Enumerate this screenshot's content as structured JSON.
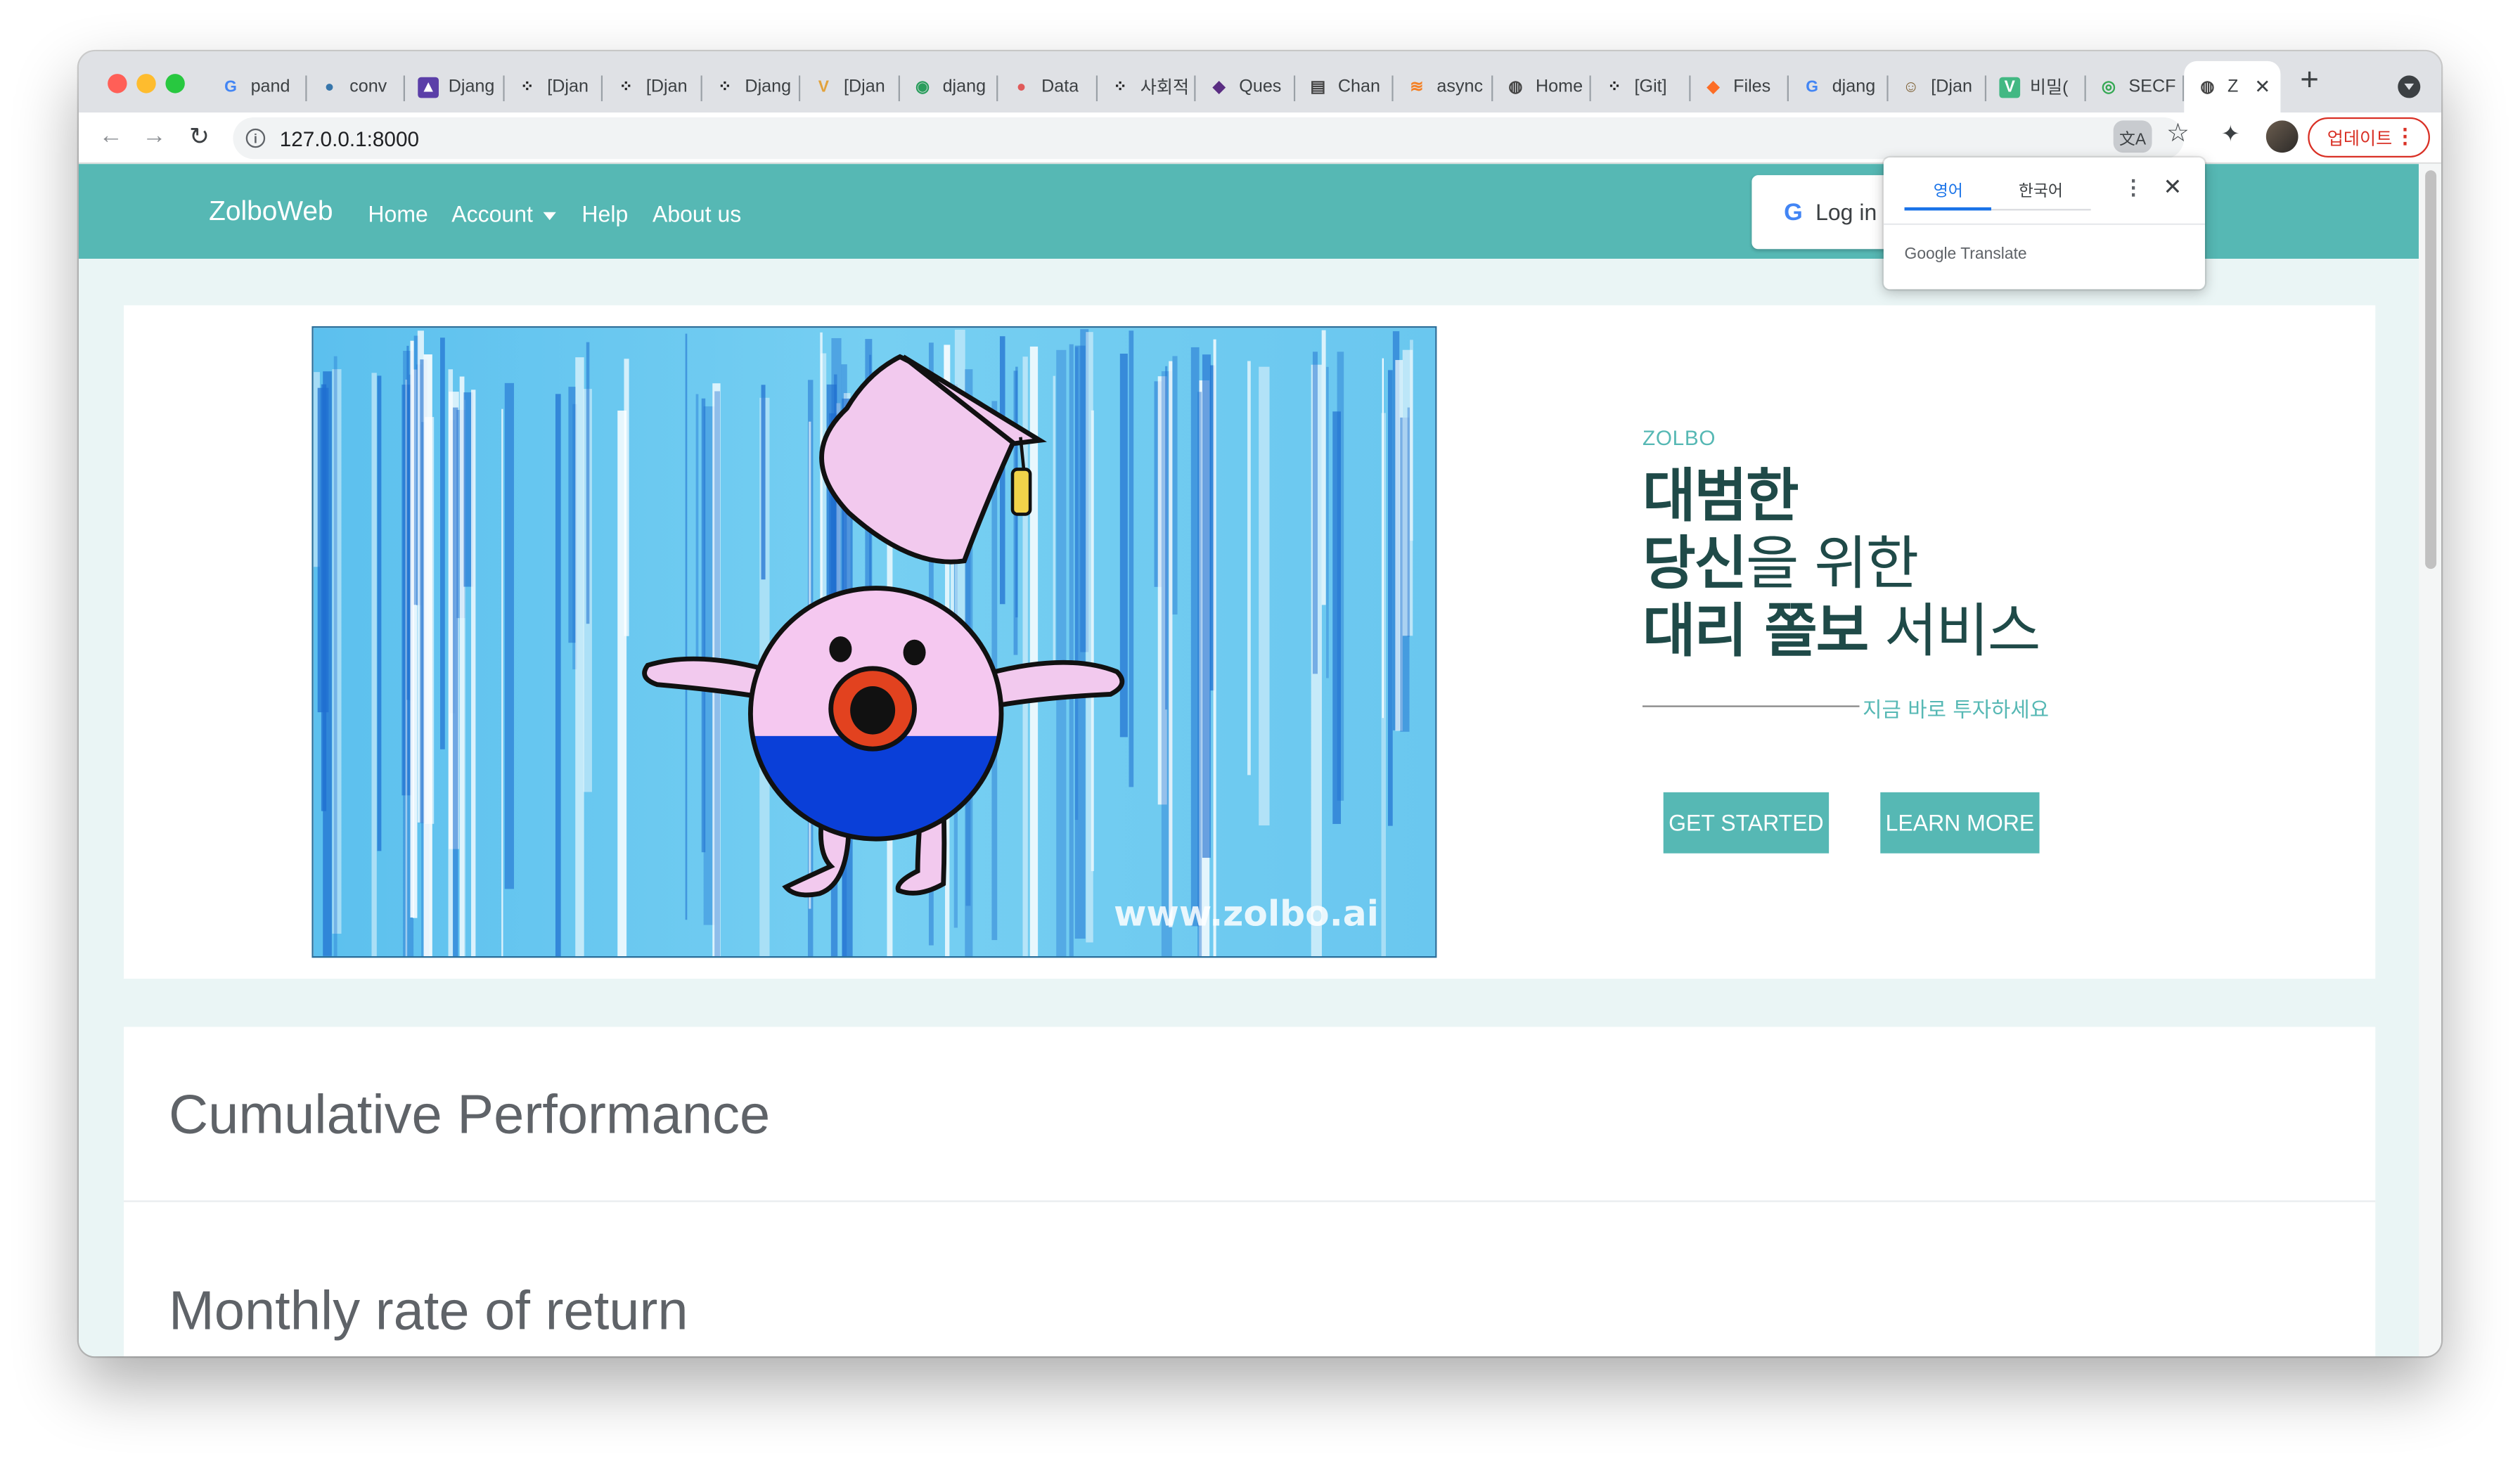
{
  "browser": {
    "tabs": [
      {
        "title": "pand",
        "icon": "google-icon"
      },
      {
        "title": "conv",
        "icon": "python-icon"
      },
      {
        "title": "Djang",
        "icon": "django-icon"
      },
      {
        "title": "[Djan",
        "icon": "dotted-icon"
      },
      {
        "title": "[Djan",
        "icon": "dotted-icon"
      },
      {
        "title": "Djang",
        "icon": "dotted-icon"
      },
      {
        "title": "[Djan",
        "icon": "vuetify-icon"
      },
      {
        "title": "djang",
        "icon": "sunglasses-icon"
      },
      {
        "title": "Data",
        "icon": "ghost-icon"
      },
      {
        "title": "사회적",
        "icon": "dotted-icon"
      },
      {
        "title": "Ques",
        "icon": "question-icon"
      },
      {
        "title": "Chan",
        "icon": "book-icon"
      },
      {
        "title": "async",
        "icon": "stack-icon"
      },
      {
        "title": "Home",
        "icon": "globe-icon"
      },
      {
        "title": "[Git]",
        "icon": "dotted-icon"
      },
      {
        "title": "Files",
        "icon": "gitlab-icon"
      },
      {
        "title": "djang",
        "icon": "google-icon"
      },
      {
        "title": "[Djan",
        "icon": "face-icon"
      },
      {
        "title": "비밀(",
        "icon": "v-icon"
      },
      {
        "title": "SECF",
        "icon": "target-icon"
      }
    ],
    "active_tab": {
      "title": "Z",
      "icon": "globe-icon"
    },
    "new_tab": "+",
    "url": "127.0.0.1:8000",
    "update_label": "업데이트"
  },
  "translate_popup": {
    "lang_en": "영어",
    "lang_ko": "한국어",
    "brand": "Google Translate"
  },
  "navbar": {
    "brand": "ZolboWeb",
    "links": {
      "home": "Home",
      "account": "Account",
      "help": "Help",
      "about": "About us"
    },
    "login": "Log in"
  },
  "hero": {
    "watermark": "www.zolbo.ai",
    "eyebrow": "ZOLBO",
    "line1": "대범한",
    "line2_bold": "당신",
    "line2_rest": "을 위한",
    "line3_bold": "대리 쫄보",
    "line3_rest": " 서비스",
    "subline": "지금 바로 투자하세요",
    "get_started": "GET STARTED",
    "learn_more": "LEARN MORE"
  },
  "performance": {
    "title": "Cumulative Performance",
    "subtitle": "Monthly rate of return"
  },
  "colors": {
    "accent": "#56b8b4",
    "heading_dark": "#1f4a48",
    "update_red": "#d93025"
  }
}
